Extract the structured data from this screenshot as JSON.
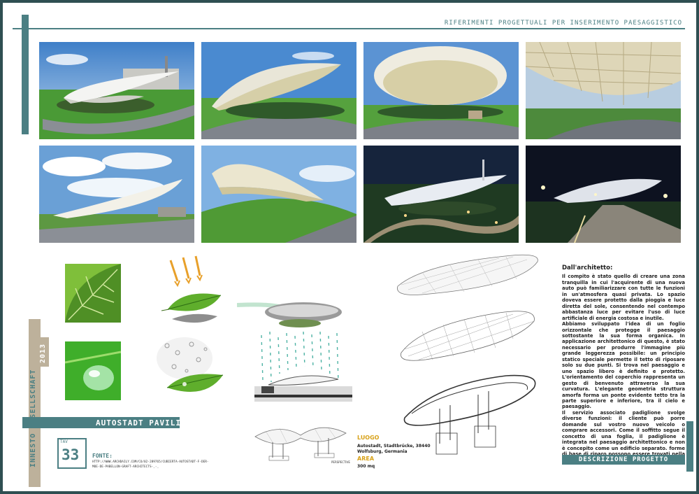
{
  "header": {
    "title": "RIFERIMENTI PROGETTUALI PER INSERIMENTO PAESAGGISTICO"
  },
  "photos": [
    {
      "scene": "day-side-view"
    },
    {
      "scene": "day-front-view"
    },
    {
      "scene": "day-canopy-view"
    },
    {
      "scene": "underside-closeup"
    },
    {
      "scene": "cloudy-sky-view"
    },
    {
      "scene": "lawn-closeup"
    },
    {
      "scene": "night-aerial"
    },
    {
      "scene": "night-walkway"
    }
  ],
  "sidebar": {
    "vertical_title": "INNESTO GESELLSCHAFT",
    "year": "2013",
    "project_name": "AUTOSTADT PAVILION",
    "tav_label": "TAV",
    "tav_number": "33",
    "fonte_label": "FONTE:",
    "fonte_url_line1": "HTTP://WWW.ARCHDAILY.COM/CO/02-289765/CUBIERTA-AUTOSTADT-F-DER-",
    "fonte_url_line2": "MOE-DE-PABELLON-GRAFT-ARCHITECTS-_-_"
  },
  "drawings": {
    "perspective_label": "PERSPECTIVE"
  },
  "info": {
    "luogo_label": "LUOGO",
    "luogo_value_line1": "Autostadt, Stadtbrücke, 38440",
    "luogo_value_line2": "Wolfsburg, Germania",
    "area_label": "AREA",
    "area_value": "300 mq"
  },
  "description": {
    "heading": "Dall'architetto:",
    "paragraphs": [
      "Il compito è stato quello di creare una zona tranquilla in cui l'acquirente di una nuova auto può familiarizzare con tutte le funzioni in un'atmosfera quasi privata. Lo spazio doveva essere protetto dalla pioggia e luce diretta del sole, consentendo nel contempo abbastanza luce per evitare l'uso di luce artificiale di energia costosa e inutile.",
      "Abbiamo sviluppato l'idea di un foglio orizzontale che protegge il paesaggio sottostante la sua forma organica. In applicazione architettonico di questo, è stato necessario per produrre l'immagine più grande leggerezza possibile: un principio statico speciale permette il tetto di riposare solo su due punti. Si trova nel paesaggio e uno spazio libero è definito e protetto. L'orientamento del coperchio rappresenta un gesto di benvenuto attraverso la sua curvatura. L'elegante geometria struttura amorfa forma un ponte evidente tetto tra la parte superiore e inferiore, tra il cielo e paesaggio.",
      "Il servizio associato padiglione svolge diverse funzioni: il cliente può porre domande sul vostro nuovo veicolo o comprare accessori. Come il soffitto segue il concetto di una foglia, il padiglione è integrata nel paesaggio architettonico e non è concepito come un edificio separato. forme di base di riparo possono essere trovati nella espressione dell'architettura interna."
    ],
    "footer_label": "DESCRIZIONE PROGETTO"
  }
}
